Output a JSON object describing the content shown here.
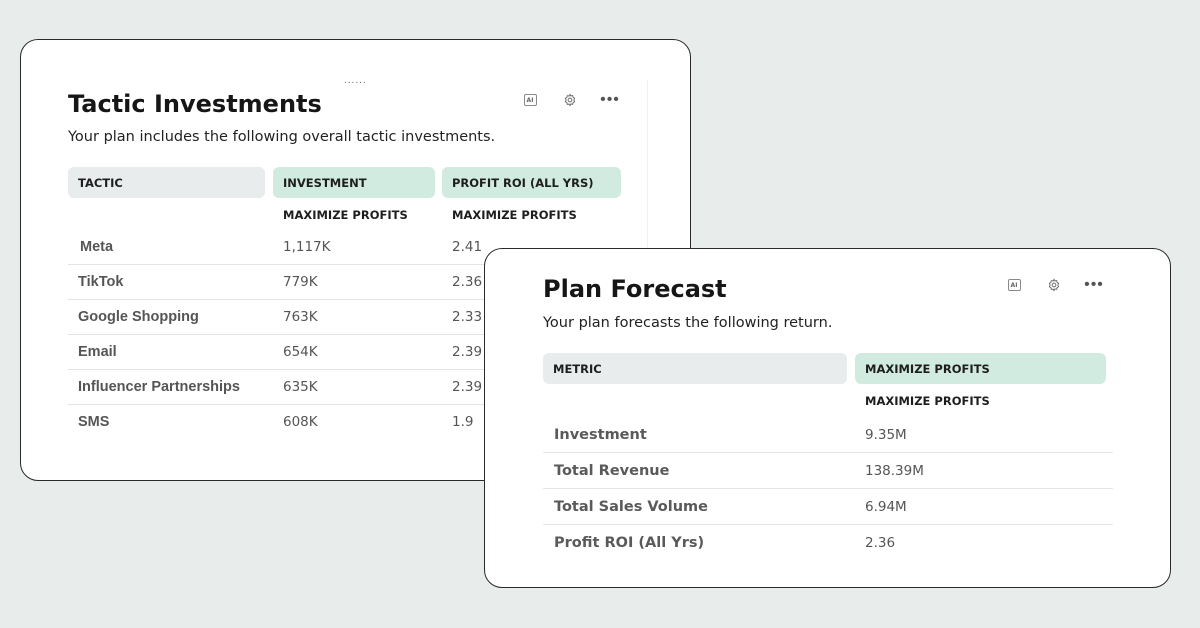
{
  "tactic_card": {
    "drag_handle": "......",
    "title": "Tactic Investments",
    "subtitle": "Your plan includes the following overall tactic investments.",
    "icons": {
      "ai": "AI",
      "settings": "gear-icon",
      "more": "more-horizontal-icon"
    },
    "columns": [
      "TACTIC",
      "INVESTMENT",
      "PROFIT ROI (ALL YRS)"
    ],
    "subheaders": [
      "MAXIMIZE PROFITS",
      "MAXIMIZE PROFITS"
    ],
    "rows": [
      {
        "tactic": "Meta",
        "investment": "1,117K",
        "roi": "2.41"
      },
      {
        "tactic": "TikTok",
        "investment": "779K",
        "roi": "2.36"
      },
      {
        "tactic": "Google Shopping",
        "investment": "763K",
        "roi": "2.33"
      },
      {
        "tactic": "Email",
        "investment": "654K",
        "roi": "2.39"
      },
      {
        "tactic": "Influencer Partnerships",
        "investment": "635K",
        "roi": "2.39"
      },
      {
        "tactic": "SMS",
        "investment": "608K",
        "roi": "1.9"
      }
    ]
  },
  "forecast_card": {
    "title": "Plan Forecast",
    "subtitle": "Your plan forecasts the following return.",
    "icons": {
      "ai": "AI",
      "settings": "gear-icon",
      "more": "more-horizontal-icon"
    },
    "columns": [
      "METRIC",
      "MAXIMIZE PROFITS"
    ],
    "subheader": "MAXIMIZE PROFITS",
    "rows": [
      {
        "metric": "Investment",
        "value": "9.35M"
      },
      {
        "metric": "Total Revenue",
        "value": "138.39M"
      },
      {
        "metric": "Total Sales Volume",
        "value": "6.94M"
      },
      {
        "metric": "Profit ROI (All Yrs)",
        "value": "2.36"
      }
    ]
  },
  "colors": {
    "background": "#e8eceb",
    "header_gray": "#e9ecec",
    "header_green": "#d1ebe0"
  }
}
